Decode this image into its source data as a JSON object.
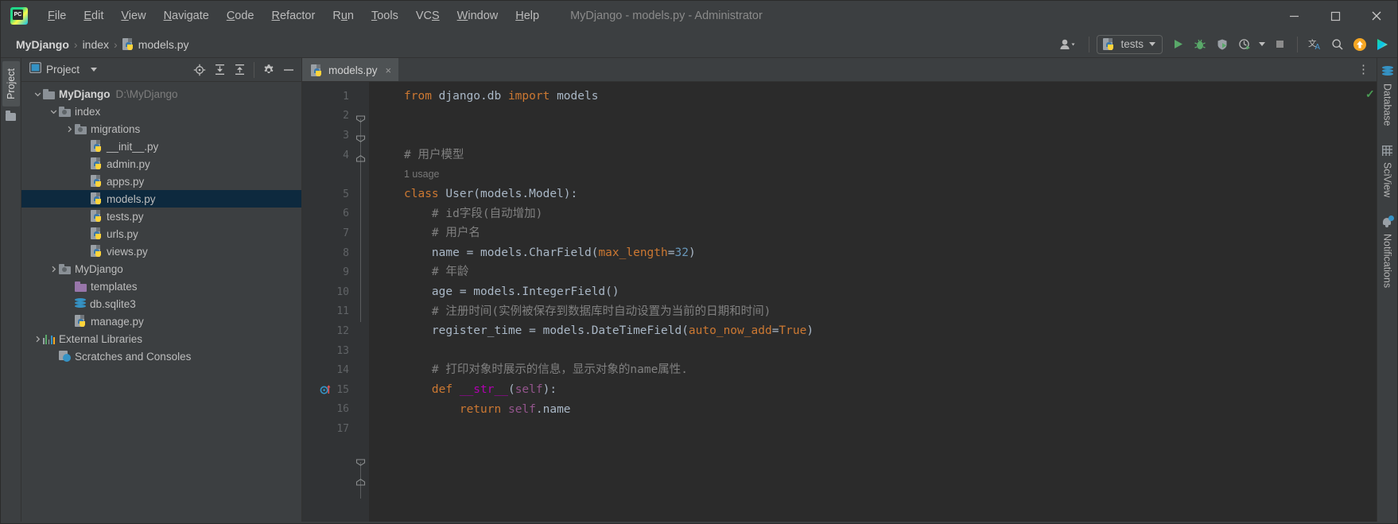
{
  "window": {
    "title": "MyDjango - models.py - Administrator",
    "logo_text": "PC",
    "minimize": "minimize-icon",
    "maximize": "maximize-icon",
    "close": "close-icon"
  },
  "menubar": {
    "items": [
      {
        "label": "File",
        "mnemonic": "F"
      },
      {
        "label": "Edit",
        "mnemonic": "E"
      },
      {
        "label": "View",
        "mnemonic": "V"
      },
      {
        "label": "Navigate",
        "mnemonic": "N"
      },
      {
        "label": "Code",
        "mnemonic": "C"
      },
      {
        "label": "Refactor",
        "mnemonic": "R"
      },
      {
        "label": "Run",
        "mnemonic": "u"
      },
      {
        "label": "Tools",
        "mnemonic": "T"
      },
      {
        "label": "VCS",
        "mnemonic": "S"
      },
      {
        "label": "Window",
        "mnemonic": "W"
      },
      {
        "label": "Help",
        "mnemonic": "H"
      }
    ]
  },
  "navbar": {
    "breadcrumbs": [
      {
        "label": "MyDjango",
        "icon": "",
        "bold": true
      },
      {
        "label": "index",
        "icon": "",
        "bold": false
      },
      {
        "label": "models.py",
        "icon": "python-file-icon",
        "bold": false
      }
    ],
    "separator": "›",
    "run_config": "tests",
    "toolbar_icons": [
      "user-account-icon",
      "run-icon",
      "debug-icon",
      "run-coverage-icon",
      "profiler-icon",
      "stop-icon",
      "translate-icon",
      "search-everywhere-icon",
      "update-icon",
      "ide-assistant-icon"
    ]
  },
  "left_stripe": {
    "tab_label": "Project",
    "folder_icon": "folder-icon"
  },
  "project_panel": {
    "title": "Project",
    "header_icons": [
      "select-opened-file-icon",
      "expand-all-icon",
      "collapse-all-icon",
      "settings-gear-icon",
      "hide-panel-icon"
    ],
    "tree": [
      {
        "label": "MyDjango",
        "path": "D:\\MyDjango",
        "icon": "folder-icon",
        "indent": 0,
        "arrow": "down",
        "bold": true,
        "selected": false
      },
      {
        "label": "index",
        "path": "",
        "icon": "source-folder-icon",
        "indent": 1,
        "arrow": "down",
        "bold": false,
        "selected": false
      },
      {
        "label": "migrations",
        "path": "",
        "icon": "source-folder-icon",
        "indent": 2,
        "arrow": "right",
        "bold": false,
        "selected": false
      },
      {
        "label": "__init__.py",
        "path": "",
        "icon": "python-file-icon",
        "indent": 3,
        "arrow": "none",
        "bold": false,
        "selected": false
      },
      {
        "label": "admin.py",
        "path": "",
        "icon": "python-file-icon",
        "indent": 3,
        "arrow": "none",
        "bold": false,
        "selected": false
      },
      {
        "label": "apps.py",
        "path": "",
        "icon": "python-file-icon",
        "indent": 3,
        "arrow": "none",
        "bold": false,
        "selected": false
      },
      {
        "label": "models.py",
        "path": "",
        "icon": "python-file-icon",
        "indent": 3,
        "arrow": "none",
        "bold": false,
        "selected": true
      },
      {
        "label": "tests.py",
        "path": "",
        "icon": "python-file-icon",
        "indent": 3,
        "arrow": "none",
        "bold": false,
        "selected": false
      },
      {
        "label": "urls.py",
        "path": "",
        "icon": "python-file-icon",
        "indent": 3,
        "arrow": "none",
        "bold": false,
        "selected": false
      },
      {
        "label": "views.py",
        "path": "",
        "icon": "python-file-icon",
        "indent": 3,
        "arrow": "none",
        "bold": false,
        "selected": false
      },
      {
        "label": "MyDjango",
        "path": "",
        "icon": "source-folder-icon",
        "indent": 1,
        "arrow": "right",
        "bold": false,
        "selected": false
      },
      {
        "label": "templates",
        "path": "",
        "icon": "template-folder-icon",
        "indent": 2,
        "arrow": "none",
        "bold": false,
        "selected": false
      },
      {
        "label": "db.sqlite3",
        "path": "",
        "icon": "database-file-icon",
        "indent": 2,
        "arrow": "none",
        "bold": false,
        "selected": false
      },
      {
        "label": "manage.py",
        "path": "",
        "icon": "python-file-icon",
        "indent": 2,
        "arrow": "none",
        "bold": false,
        "selected": false
      },
      {
        "label": "External Libraries",
        "path": "",
        "icon": "libraries-icon",
        "indent": 0,
        "arrow": "right",
        "bold": false,
        "selected": false
      },
      {
        "label": "Scratches and Consoles",
        "path": "",
        "icon": "scratches-icon",
        "indent": 1,
        "arrow": "none",
        "bold": false,
        "selected": false
      }
    ]
  },
  "editor": {
    "tab": {
      "label": "models.py",
      "icon": "python-file-icon",
      "close": "×"
    },
    "options_icon": "editor-options-icon",
    "inspection_status": "✓",
    "lines": [
      {
        "num": "1",
        "tokens": [
          {
            "t": "from",
            "c": "kw"
          },
          {
            "t": " django.db ",
            "c": "pl"
          },
          {
            "t": "import",
            "c": "kw"
          },
          {
            "t": " models",
            "c": "pl"
          }
        ]
      },
      {
        "num": "2",
        "tokens": []
      },
      {
        "num": "3",
        "tokens": []
      },
      {
        "num": "4",
        "tokens": [
          {
            "t": "# 用户模型",
            "c": "cm"
          }
        ]
      },
      {
        "num": "",
        "inlay": "1 usage"
      },
      {
        "num": "5",
        "tokens": [
          {
            "t": "class",
            "c": "kw"
          },
          {
            "t": " User(models.Model):",
            "c": "pl"
          }
        ]
      },
      {
        "num": "6",
        "tokens": [
          {
            "t": "    # id字段(自动增加)",
            "c": "cm"
          }
        ]
      },
      {
        "num": "7",
        "tokens": [
          {
            "t": "    # 用户名",
            "c": "cm"
          }
        ]
      },
      {
        "num": "8",
        "tokens": [
          {
            "t": "    name = models.CharField(",
            "c": "pl"
          },
          {
            "t": "max_length",
            "c": "param"
          },
          {
            "t": "=",
            "c": "pl"
          },
          {
            "t": "32",
            "c": "num"
          },
          {
            "t": ")",
            "c": "pl"
          }
        ]
      },
      {
        "num": "9",
        "tokens": [
          {
            "t": "    # 年龄",
            "c": "cm"
          }
        ]
      },
      {
        "num": "10",
        "tokens": [
          {
            "t": "    age = models.IntegerField()",
            "c": "pl"
          }
        ]
      },
      {
        "num": "11",
        "tokens": [
          {
            "t": "    # 注册时间(实例被保存到数据库时自动设置为当前的日期和时间)",
            "c": "cm"
          }
        ]
      },
      {
        "num": "12",
        "tokens": [
          {
            "t": "    register_time = models.DateTimeField(",
            "c": "pl"
          },
          {
            "t": "auto_now_add",
            "c": "param"
          },
          {
            "t": "=",
            "c": "pl"
          },
          {
            "t": "True",
            "c": "kw"
          },
          {
            "t": ")",
            "c": "pl"
          }
        ]
      },
      {
        "num": "13",
        "tokens": []
      },
      {
        "num": "14",
        "tokens": [
          {
            "t": "    # 打印对象时展示的信息，显示对象的name属性.",
            "c": "cm"
          }
        ]
      },
      {
        "num": "15",
        "tokens": [
          {
            "t": "    def",
            "c": "kw"
          },
          {
            "t": " ",
            "c": "pl"
          },
          {
            "t": "__str__",
            "c": "fn"
          },
          {
            "t": "(",
            "c": "pl"
          },
          {
            "t": "self",
            "c": "selfkw"
          },
          {
            "t": "):",
            "c": "pl"
          }
        ],
        "gutter_icon": "override-method-icon"
      },
      {
        "num": "16",
        "tokens": [
          {
            "t": "        ",
            "c": "pl"
          },
          {
            "t": "return",
            "c": "kw"
          },
          {
            "t": " ",
            "c": "pl"
          },
          {
            "t": "self",
            "c": "selfkw"
          },
          {
            "t": ".name",
            "c": "pl"
          }
        ]
      },
      {
        "num": "17",
        "tokens": []
      }
    ]
  },
  "right_stripe": {
    "tabs": [
      {
        "label": "Database",
        "icon": "database-icon"
      },
      {
        "label": "SciView",
        "icon": "sciview-grid-icon"
      },
      {
        "label": "Notifications",
        "icon": "notifications-bell-icon"
      }
    ]
  },
  "colors": {
    "keyword": "#cc7832",
    "number": "#6897bb",
    "comment": "#808080",
    "function": "#b200b2",
    "self": "#94558d",
    "plain": "#a9b7c6",
    "selection": "#0d293e",
    "editor_bg": "#2b2b2b",
    "panel_bg": "#3c3f41",
    "accent_green": "#499c54"
  }
}
